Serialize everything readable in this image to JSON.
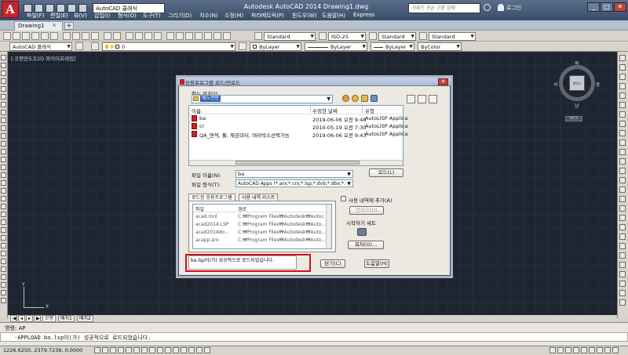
{
  "titlebar": {
    "workspace": "AutoCAD 클래식",
    "app_title": "Autodesk AutoCAD 2014    Drawing1.dwg",
    "search_placeholder": "키워드 또는 구문 입력",
    "login": "로그인",
    "minimize": "_",
    "maximize": "□",
    "close": "✕"
  },
  "menu": [
    "파일(F)",
    "편집(E)",
    "뷰(V)",
    "삽입(I)",
    "형식(O)",
    "도구(T)",
    "그리기(D)",
    "치수(N)",
    "수정(M)",
    "파라메트릭(P)",
    "윈도우(W)",
    "도움말(H)",
    "Express"
  ],
  "doc_tab": {
    "name": "Drawing1",
    "close": "x",
    "new": "+"
  },
  "toolbar": {
    "text_style": "Standard",
    "dim_style": "ISO-25",
    "table_style": "Standard",
    "mleader_style": "Standard",
    "workspace2": "AutoCAD 클래식",
    "layer": "0",
    "color": "ByLayer",
    "linetype": "ByLayer",
    "lineweight": "ByLayer",
    "plotstyle": "ByColor"
  },
  "viewport_label": "[-][평면도][2D 와이어프레임]",
  "viewcube": {
    "north": "북",
    "south": "남",
    "east": "동",
    "west": "서",
    "face": "평면도",
    "wcs": "WCS"
  },
  "ucs": {
    "x": "X",
    "y": "Y"
  },
  "layout_tabs": [
    "모형",
    "배치1",
    "배치2"
  ],
  "command_line": {
    "history": "명령: AP",
    "current": "-APPLOAD ba.lsp이(가) 성공적으로 로드되었습니다."
  },
  "status": {
    "coords": "1226.6250, 2379.7239, 0.0000"
  },
  "dialog": {
    "title": "응용프로그램 로드/언로드",
    "close": "✕",
    "look_in_label": "찾는 위치(I):",
    "look_in_value": "배도면판",
    "columns": {
      "name": "이름",
      "date": "수정한 날짜",
      "type": "유형"
    },
    "files": [
      {
        "name": "ba",
        "date": "2019-06-06 오전 9:48",
        "type": "AutoLISP Applica"
      },
      {
        "name": "cr",
        "date": "2010-05-19 오전 7:30",
        "type": "AutoLISP Applica"
      },
      {
        "name": "QA_면적, 둘, 재공미터, 여러박스선택가능",
        "date": "2019-06-06 오전 9:43",
        "type": "AutoLISP Applica"
      }
    ],
    "file_name_label": "파일 이름(N):",
    "file_name_value": "ba",
    "file_type_label": "파일 형식(T):",
    "file_type_value": "AutoCAD Apps (*.arx;*.crx;*.lsp;*.dvb;*.dbx;*.",
    "load_button": "로드(L)",
    "tab_loaded": "로드된 응용프로그램",
    "tab_history": "사용 내역 리스트",
    "loaded_columns": {
      "file": "파일",
      "path": "경로"
    },
    "loaded_apps": [
      {
        "file": "acad.mnl",
        "path": "C:₩Program Files₩Autodesk₩Autoc..."
      },
      {
        "file": "acad2014.LSP",
        "path": "C:₩Program Files₩Autodesk₩Auto..."
      },
      {
        "file": "acad2014do...",
        "path": "C:₩Program Files₩Autodesk₩Auto..."
      },
      {
        "file": "acapp.arx",
        "path": "C:₩Program Files₩Autodesk₩Auto..."
      }
    ],
    "add_history_label": "사용 내역에 추가(A)",
    "unload_button": "언로드(U)",
    "startup_suite_label": "시작하기 세트",
    "contents_button": "목차(O)...",
    "message": "ba.lsp이(가) 성공적으로 로드되었습니다.",
    "close_button": "닫기(C)",
    "help_button": "도움말(H)"
  }
}
